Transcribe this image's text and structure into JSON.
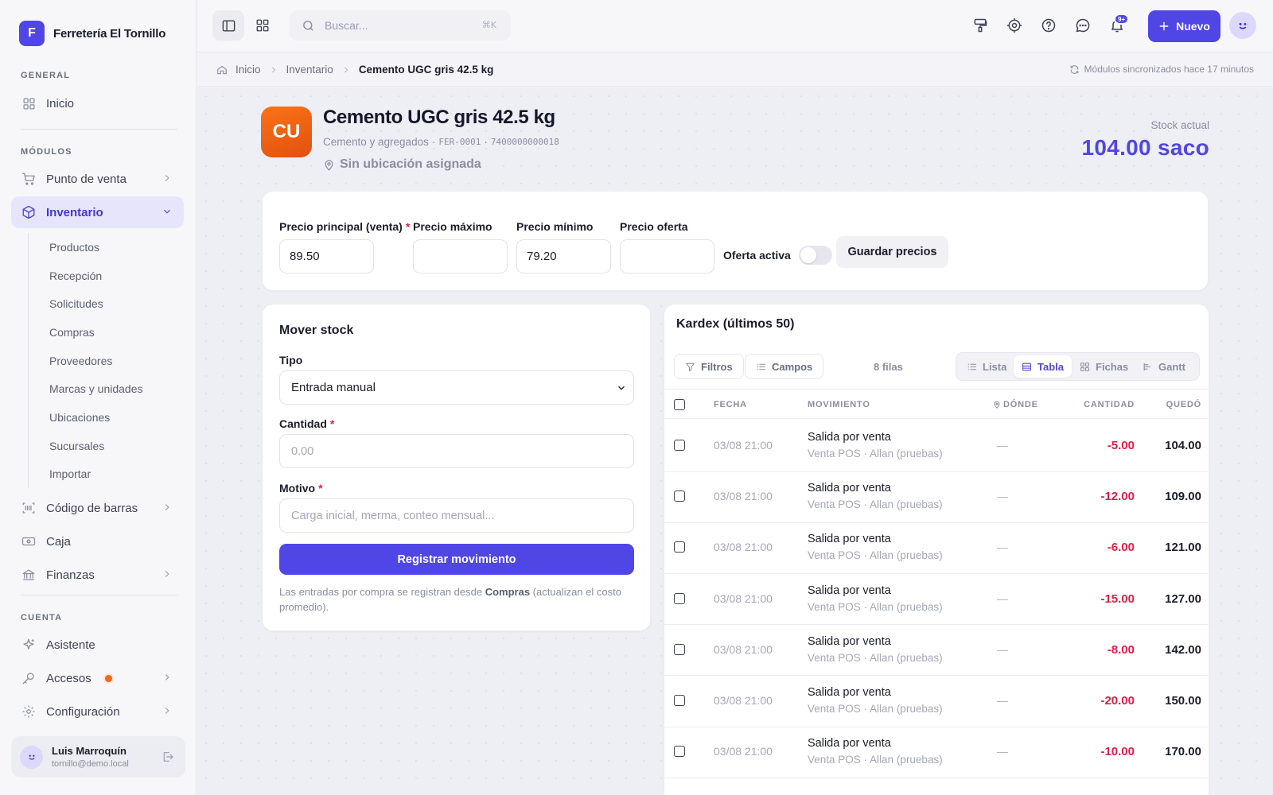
{
  "brand": {
    "initial": "F",
    "name": "Ferretería El Tornillo"
  },
  "sidebar": {
    "section_general": "GENERAL",
    "section_modules": "MÓDULOS",
    "section_account": "CUENTA",
    "items": [
      {
        "label": "Inicio",
        "icon": "grid-icon"
      },
      {
        "label": "Punto de venta",
        "icon": "cart-icon"
      },
      {
        "label": "Inventario",
        "icon": "box-icon"
      },
      {
        "label": "Código de barras",
        "icon": "barcode-icon"
      },
      {
        "label": "Caja",
        "icon": "cash-icon"
      },
      {
        "label": "Finanzas",
        "icon": "bank-icon"
      },
      {
        "label": "Asistente",
        "icon": "sparkle-icon"
      },
      {
        "label": "Accesos",
        "icon": "key-icon"
      },
      {
        "label": "Configuración",
        "icon": "gear-icon"
      }
    ],
    "inventory_sub": [
      "Productos",
      "Recepción",
      "Solicitudes",
      "Compras",
      "Proveedores",
      "Marcas y unidades",
      "Ubicaciones",
      "Sucursales",
      "Importar"
    ],
    "user": {
      "name": "Luis Marroquín",
      "email": "tornillo@demo.local"
    }
  },
  "topbar": {
    "search_placeholder": "Buscar...",
    "search_shortcut": "⌘K",
    "notifications_badge": "9+",
    "new_label": "Nuevo"
  },
  "breadcrumb": {
    "items": [
      "Inicio",
      "Inventario",
      "Cemento UGC gris 42.5 kg"
    ],
    "sync_status": "Módulos sincronizados hace 17 minutos"
  },
  "product": {
    "initials": "CU",
    "name": "Cemento UGC gris 42.5 kg",
    "category": "Cemento y agregados",
    "sku": "FER-0001",
    "barcode": "7400000000018",
    "location": "Sin ubicación asignada",
    "stock_label": "Stock actual",
    "stock_value": "104.00 saco"
  },
  "prices": {
    "main_label": "Precio principal (venta)",
    "main_value": "89.50",
    "max_label": "Precio máximo",
    "max_value": "",
    "min_label": "Precio mínimo",
    "min_value": "79.20",
    "offer_label": "Precio oferta",
    "offer_value": "",
    "offer_active_label": "Oferta activa",
    "offer_active": false,
    "save_label": "Guardar precios"
  },
  "move": {
    "title": "Mover stock",
    "type_label": "Tipo",
    "type_value": "Entrada manual",
    "qty_label": "Cantidad",
    "qty_placeholder": "0.00",
    "reason_label": "Motivo",
    "reason_placeholder": "Carga inicial, merma, conteo mensual...",
    "submit_label": "Registrar movimiento",
    "note_before": "Las entradas por compra se registran desde ",
    "note_link": "Compras",
    "note_after": " (actualizan el costo promedio)."
  },
  "kardex": {
    "title": "Kardex (últimos 50)",
    "filters_label": "Filtros",
    "fields_label": "Campos",
    "rows_count": "8 filas",
    "views": [
      "Lista",
      "Tabla",
      "Fichas",
      "Gantt"
    ],
    "active_view": "Tabla",
    "headers": [
      "FECHA",
      "MOVIMIENTO",
      "DÓNDE",
      "CANTIDAD",
      "QUEDÓ"
    ],
    "rows": [
      {
        "date": "03/08 21:00",
        "title": "Salida por venta",
        "detail": "Venta POS · Allan (pruebas)",
        "where": "—",
        "qty": "-5.00",
        "left": "104.00"
      },
      {
        "date": "03/08 21:00",
        "title": "Salida por venta",
        "detail": "Venta POS · Allan (pruebas)",
        "where": "—",
        "qty": "-12.00",
        "left": "109.00"
      },
      {
        "date": "03/08 21:00",
        "title": "Salida por venta",
        "detail": "Venta POS · Allan (pruebas)",
        "where": "—",
        "qty": "-6.00",
        "left": "121.00"
      },
      {
        "date": "03/08 21:00",
        "title": "Salida por venta",
        "detail": "Venta POS · Allan (pruebas)",
        "where": "—",
        "qty": "-15.00",
        "left": "127.00"
      },
      {
        "date": "03/08 21:00",
        "title": "Salida por venta",
        "detail": "Venta POS · Allan (pruebas)",
        "where": "—",
        "qty": "-8.00",
        "left": "142.00"
      },
      {
        "date": "03/08 21:00",
        "title": "Salida por venta",
        "detail": "Venta POS · Allan (pruebas)",
        "where": "—",
        "qty": "-20.00",
        "left": "150.00"
      },
      {
        "date": "03/08 21:00",
        "title": "Salida por venta",
        "detail": "Venta POS · Allan (pruebas)",
        "where": "—",
        "qty": "-10.00",
        "left": "170.00"
      }
    ]
  },
  "colors": {
    "accent": "#4f46e5",
    "negative": "#e11d48",
    "product_badge": "#f97316"
  }
}
